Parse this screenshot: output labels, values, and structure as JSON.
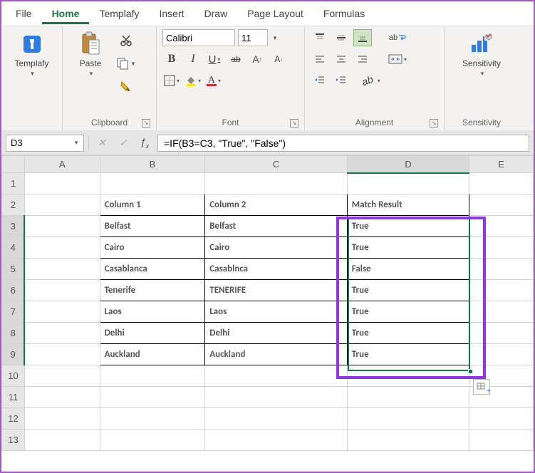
{
  "menu": {
    "items": [
      "File",
      "Home",
      "Templafy",
      "Insert",
      "Draw",
      "Page Layout",
      "Formulas"
    ],
    "active": "Home"
  },
  "ribbon": {
    "templafy": {
      "label": "Templafy"
    },
    "clipboard": {
      "group_label": "Clipboard",
      "paste_label": "Paste"
    },
    "font": {
      "group_label": "Font",
      "name": "Calibri",
      "size": "11",
      "bold": "B",
      "italic": "I",
      "underline": "U",
      "strikethrough": "ab",
      "inc_a": "A",
      "dec_a": "A"
    },
    "alignment": {
      "group_label": "Alignment",
      "wrap": "ab"
    },
    "sensitivity": {
      "group_label": "Sensitivity",
      "btn_label": "Sensitivity"
    }
  },
  "formula_bar": {
    "cell_ref": "D3",
    "formula": "=IF(B3=C3, \"True\", \"False\")"
  },
  "grid": {
    "columns": [
      "A",
      "B",
      "C",
      "D",
      "E"
    ],
    "active_col": "D",
    "rows": [
      "1",
      "2",
      "3",
      "4",
      "5",
      "6",
      "7",
      "8",
      "9",
      "10",
      "11",
      "12",
      "13"
    ],
    "active_row": "3",
    "headers": {
      "col1": "Column 1",
      "col2": "Column 2",
      "match": "Match Result"
    },
    "data_rows": [
      {
        "c1": "Belfast",
        "c2": "Belfast",
        "m": "True"
      },
      {
        "c1": "Cairo",
        "c2": "Cairo",
        "m": "True"
      },
      {
        "c1": "Casablanca",
        "c2": "Casablnca",
        "m": "False"
      },
      {
        "c1": "Tenerife",
        "c2": "TENERIFE",
        "m": "True"
      },
      {
        "c1": "Laos",
        "c2": "Laos",
        "m": "True"
      },
      {
        "c1": "Delhi",
        "c2": "Delhi",
        "m": "True"
      },
      {
        "c1": "Auckland",
        "c2": "Auckland",
        "m": "True"
      }
    ]
  }
}
